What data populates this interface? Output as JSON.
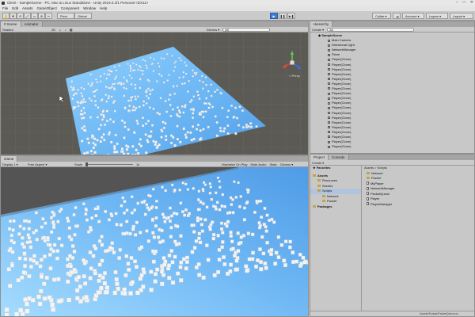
{
  "window": {
    "title": "Client - SampleScene - PC, Mac & Linux Standalone - Unity 2019.3.1f1 Personal <DX11>",
    "controls": [
      "–",
      "□",
      "✕"
    ]
  },
  "menu": [
    "File",
    "Edit",
    "Assets",
    "GameObject",
    "Component",
    "Window",
    "Help"
  ],
  "toolbar": {
    "tools": [
      "✋",
      "✥",
      "⟲",
      "⤢",
      "▭",
      "⊕",
      "✂"
    ],
    "pivot": "Pivot",
    "global": "Global",
    "play": "▶",
    "pause": "❚❚",
    "step": "▶❚",
    "right_items": [
      "Collab ▾",
      "☁",
      "Account ▾",
      "Layers ▾",
      "Layout ▾"
    ]
  },
  "scene": {
    "tabs": [
      "# Scene",
      "Animator"
    ],
    "shading": "Shaded",
    "mode_2d": "2D",
    "gizmos": "Gizmos ▾",
    "search_placeholder": "All",
    "persp_label": "< Persp",
    "axes": {
      "x": "x",
      "y": "y",
      "z": "z"
    }
  },
  "game": {
    "tab": "Game",
    "display": "Display 1 ▾",
    "aspect": "Free Aspect ▾",
    "scale_label": "Scale",
    "scale_value": "1x",
    "options": [
      "Maximize On Play",
      "Mute Audio",
      "Stats",
      "Gizmos ▾"
    ]
  },
  "hierarchy": {
    "tab": "Hierarchy",
    "create": "Create ▾",
    "search_placeholder": "All",
    "scene": "SampleScene",
    "items": [
      "Main Camera",
      "Directional Light",
      "NetworkManager",
      "Plane",
      "Player(Clone)",
      "Player(Clone)",
      "Player(Clone)",
      "Player(Clone)",
      "Player(Clone)",
      "Player(Clone)",
      "Player(Clone)",
      "Player(Clone)",
      "Player(Clone)",
      "Player(Clone)",
      "Player(Clone)",
      "Player(Clone)",
      "Player(Clone)",
      "Player(Clone)",
      "Player(Clone)",
      "Player(Clone)",
      "Player(Clone)",
      "Player(Clone)",
      "Player(Clone)"
    ]
  },
  "project": {
    "tabs": [
      "Project",
      "Console"
    ],
    "create": "Create ▾",
    "favorites": "Favorites",
    "assets": "Assets",
    "tree": [
      "Resources",
      "Scenes",
      "Scripts",
      "Network",
      "Packet"
    ],
    "packages": "Packages",
    "breadcrumb": "Assets > Scripts",
    "files": [
      {
        "name": "Network",
        "kind": "folder"
      },
      {
        "name": "Packet",
        "kind": "folder"
      },
      {
        "name": "MyPlayer",
        "kind": "script"
      },
      {
        "name": "NetworkManager",
        "kind": "script"
      },
      {
        "name": "PacketQueue",
        "kind": "script"
      },
      {
        "name": "Player",
        "kind": "script"
      },
      {
        "name": "PlayerManager",
        "kind": "script"
      }
    ],
    "status_path": "Assets/Scripts/PacketQueue.cs"
  },
  "colors": {
    "scene_bg": "#5c5a55",
    "plane_light": "#a6dcff",
    "plane_dark": "#4f9be6",
    "play_blue": "#3d7dd6"
  }
}
